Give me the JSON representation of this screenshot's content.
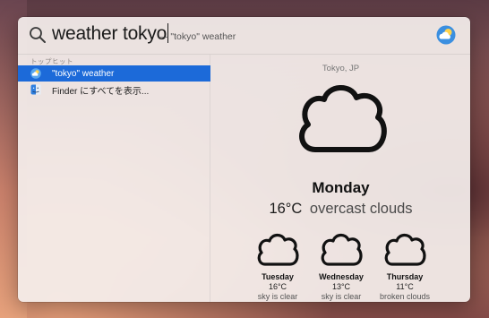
{
  "search": {
    "query": "weather tokyo",
    "completion": "— \"tokyo\" weather"
  },
  "results": {
    "section_label": "トップヒット",
    "items": [
      {
        "label": "\"tokyo\" weather",
        "icon": "weather-icon",
        "selected": true
      },
      {
        "label": "Finder にすべてを表示...",
        "icon": "finder-icon",
        "selected": false
      }
    ]
  },
  "weather": {
    "location": "Tokyo, JP",
    "day": "Monday",
    "temperature": "16°C",
    "condition": "overcast clouds",
    "forecast": [
      {
        "day": "Tuesday",
        "temp": "16°C",
        "condition": "sky is clear",
        "icon": "cloud-icon"
      },
      {
        "day": "Wednesday",
        "temp": "13°C",
        "condition": "sky is clear",
        "icon": "cloud-icon"
      },
      {
        "day": "Thursday",
        "temp": "11°C",
        "condition": "broken clouds",
        "icon": "cloud-icon"
      }
    ]
  },
  "colors": {
    "selection": "#1c6ad9",
    "panel": "#f4eeec"
  }
}
